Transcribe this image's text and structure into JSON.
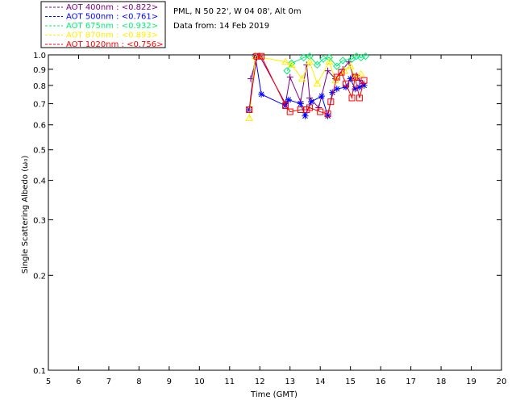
{
  "chart_data": {
    "type": "scatter",
    "header": [
      "PML, N 50 22', W 04 08', Alt 0m",
      "Data from: 14 Feb 2019"
    ],
    "xlabel": "Time (GMT)",
    "ylabel": "Single Scattering Albedo (ω₀)",
    "xlim": [
      5,
      20
    ],
    "ylim": [
      0.1,
      1.0
    ],
    "yscale": "log",
    "xticks": [
      5,
      6,
      7,
      8,
      9,
      10,
      11,
      12,
      13,
      14,
      15,
      16,
      17,
      18,
      19,
      20
    ],
    "yticks": [
      0.1,
      0.2,
      0.3,
      0.4,
      0.5,
      0.6,
      0.7,
      0.8,
      0.9,
      1.0
    ],
    "xtick_labels": [
      "5",
      "6",
      "7",
      "8",
      "9",
      "10",
      "11",
      "12",
      "13",
      "14",
      "15",
      "16",
      "17",
      "18",
      "19",
      "20"
    ],
    "ytick_labels": [
      "0.1",
      "0.2",
      "0.3",
      "0.4",
      "0.5",
      "0.6",
      "0.7",
      "0.8",
      "0.9",
      "1.0"
    ],
    "grid": false,
    "legend_position": "top-left outside",
    "series": [
      {
        "name": "AOT  400nm : <0.822>",
        "color": "#7b0082",
        "marker": "plus",
        "x": [
          11.7,
          11.9,
          12.0,
          12.85,
          13.0,
          13.35,
          13.55,
          13.65,
          13.95,
          14.25,
          14.5,
          14.75,
          14.95,
          15.1,
          15.2,
          15.3,
          15.4
        ],
        "y": [
          0.84,
          0.98,
          0.99,
          0.7,
          0.85,
          0.71,
          0.93,
          0.73,
          0.68,
          0.89,
          0.84,
          0.9,
          0.95,
          0.85,
          0.86,
          0.83,
          0.81
        ]
      },
      {
        "name": "AOT  500nm : <0.761>",
        "color": "#0000ff",
        "marker": "asterisk",
        "x": [
          11.65,
          11.85,
          12.05,
          12.85,
          12.95,
          13.35,
          13.5,
          13.7,
          14.05,
          14.25,
          14.4,
          14.55,
          14.85,
          15.0,
          15.15,
          15.3,
          15.45
        ],
        "y": [
          0.67,
          0.99,
          0.75,
          0.69,
          0.72,
          0.7,
          0.64,
          0.71,
          0.74,
          0.64,
          0.76,
          0.78,
          0.79,
          0.84,
          0.78,
          0.79,
          0.8
        ]
      },
      {
        "name": "AOT  675nm : <0.932>",
        "color": "#00ee77",
        "marker": "diamond",
        "x": [
          12.9,
          13.05,
          13.45,
          13.65,
          13.9,
          14.1,
          14.3,
          14.55,
          14.75,
          15.05,
          15.2,
          15.35,
          15.5
        ],
        "y": [
          0.89,
          0.94,
          0.98,
          0.99,
          0.93,
          0.97,
          0.98,
          0.92,
          0.96,
          0.97,
          0.99,
          0.98,
          0.99
        ]
      },
      {
        "name": "AOT  870nm : <0.893>",
        "color": "#ffee00",
        "marker": "triangle",
        "x": [
          11.65,
          11.85,
          12.85,
          13.05,
          13.4,
          13.65,
          13.9,
          14.3,
          14.5,
          14.8,
          15.0,
          15.15,
          15.35
        ],
        "y": [
          0.63,
          0.99,
          0.95,
          0.93,
          0.84,
          0.95,
          0.81,
          0.95,
          0.83,
          0.89,
          0.92,
          0.85,
          0.87
        ]
      },
      {
        "name": "AOT 1020nm : <0.756>",
        "color": "#ff0000",
        "marker": "square",
        "x": [
          11.65,
          11.9,
          12.05,
          12.85,
          13.0,
          13.35,
          13.55,
          13.65,
          14.0,
          14.25,
          14.35,
          14.55,
          14.7,
          14.85,
          15.05,
          15.15,
          15.3,
          15.45
        ],
        "y": [
          0.67,
          0.99,
          0.99,
          0.69,
          0.66,
          0.67,
          0.67,
          0.68,
          0.66,
          0.65,
          0.71,
          0.85,
          0.88,
          0.81,
          0.73,
          0.85,
          0.73,
          0.83
        ]
      }
    ]
  }
}
